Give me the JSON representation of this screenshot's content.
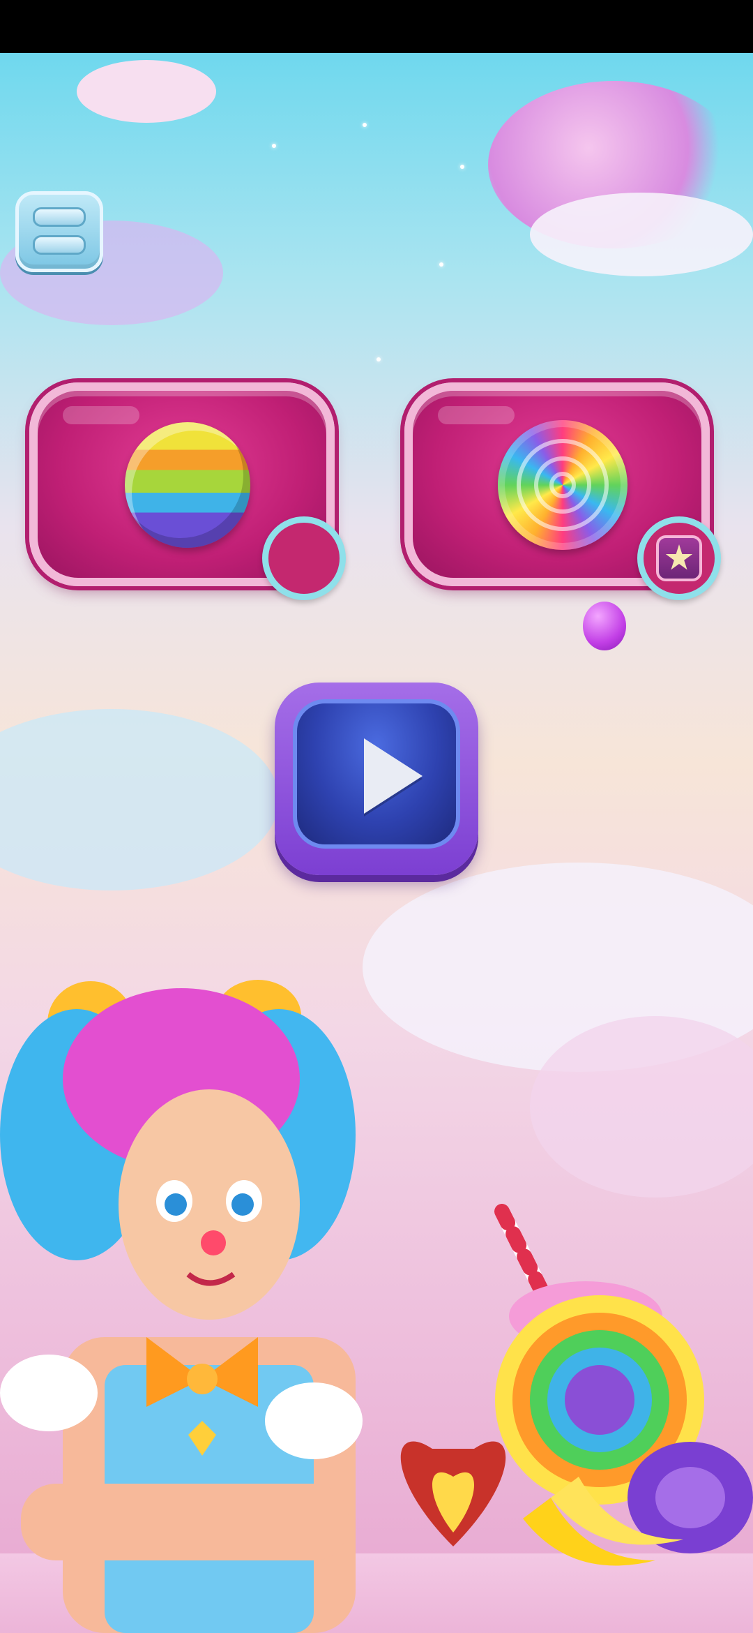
{
  "screen": {
    "name": "candy-game-main-menu",
    "background_colors": {
      "sky_top": "#6fd8ee",
      "mid": "#f7e5d8",
      "bottom": "#e7a6d0"
    }
  },
  "menu_button": {
    "icon": "hamburger-menu-icon"
  },
  "mode_cards": [
    {
      "id": "rainbow-ball-mode",
      "icon": "rainbow-ball-icon",
      "badge_icon": "empty-badge"
    },
    {
      "id": "lollipop-mode",
      "icon": "lollipop-icon",
      "badge_icon": "star-icon"
    }
  ],
  "play_button": {
    "icon": "play-icon",
    "accent": "#7c3fd2"
  },
  "decor": {
    "character": "candy-girl-illustration",
    "candies": [
      "rainbow-candy-cake",
      "heart-candy",
      "bananas",
      "wrapped-purple-candy"
    ]
  }
}
